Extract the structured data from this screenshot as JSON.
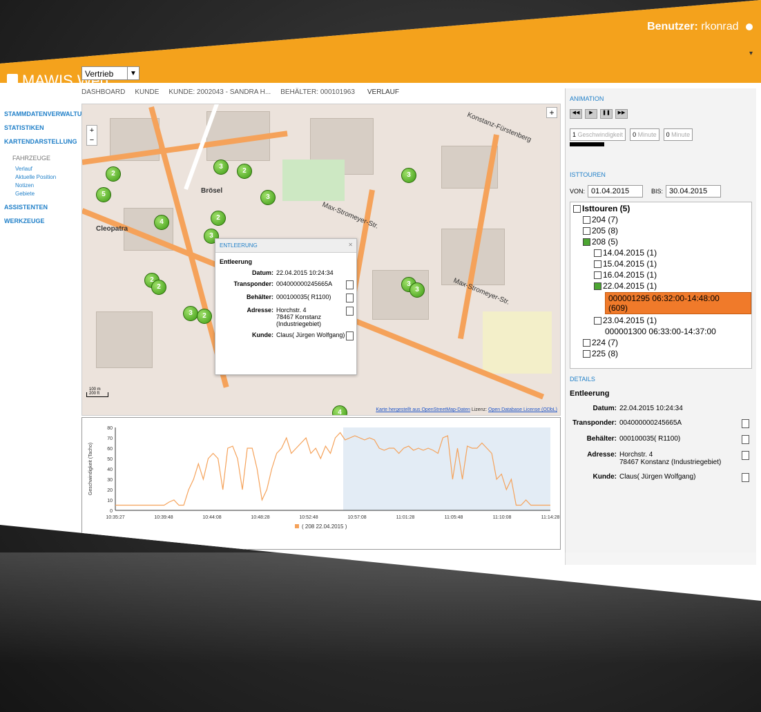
{
  "topbar": {
    "user_label": "Benutzer:",
    "user_name": "rkonrad",
    "app_title": "MAWIS Web",
    "mode": "Vertrieb"
  },
  "sidebar": {
    "items": [
      "STAMMDATENVERWALTUNG",
      "STATISTIKEN",
      "KARTENDARSTELLUNG"
    ],
    "sub_header": "FAHRZEUGE",
    "links": [
      "Verlauf",
      "Aktuelle Position",
      "Notizen",
      "Gebiete"
    ],
    "items2": [
      "ASSISTENTEN",
      "WERKZEUGE"
    ]
  },
  "breadcrumbs": [
    "DASHBOARD",
    "KUNDE",
    "KUNDE: 2002043 - SANDRA H...",
    "BEHÄLTER: 000101963",
    "VERLAUF"
  ],
  "map": {
    "attribution_link1": "Karte hergestellt aus OpenStreetMap-Daten",
    "attribution_mid": "Lizenz:",
    "attribution_link2": "Open Database License (ODbL)",
    "streets": [
      "Max-Stromeyer-Str.",
      "Max-Stromeyer-Str.",
      "Konstanz-Fürstenberg"
    ],
    "labels": [
      "Cleopatra",
      "Brösel"
    ],
    "markers": [
      "2",
      "5",
      "4",
      "3",
      "2",
      "2",
      "3",
      "3",
      "3",
      "2",
      "2",
      "2",
      "3",
      "3",
      "3",
      "4"
    ],
    "scale": [
      "100 m",
      "200 ft"
    ]
  },
  "popup": {
    "title": "ENTLEERUNG",
    "heading": "Entleerung",
    "rows": [
      {
        "k": "Datum:",
        "v": "22.04.2015 10:24:34"
      },
      {
        "k": "Transponder:",
        "v": "004000000245665A"
      },
      {
        "k": "Behälter:",
        "v": "000100035( R1100)"
      },
      {
        "k": "Adresse:",
        "v": "Horchstr. 4",
        "v2": "78467 Konstanz (Industriegebiet)"
      },
      {
        "k": "Kunde:",
        "v": "Claus( Jürgen Wolfgang)"
      }
    ]
  },
  "chart_data": {
    "type": "line",
    "ylabel": "Geschwindigkeit (Tacho)",
    "ylim": [
      0,
      80
    ],
    "yticks": [
      "80",
      "70",
      "60",
      "50",
      "40",
      "30",
      "20",
      "10",
      "0"
    ],
    "x_ticks": [
      "10:35:27",
      "10:39:48",
      "10:44:08",
      "10:48:28",
      "10:52:48",
      "10:57:08",
      "11:01:28",
      "11:05:48",
      "11:10:08",
      "11:14:28"
    ],
    "legend": "( 208 22.04.2015 )",
    "values": [
      5,
      5,
      5,
      5,
      5,
      5,
      5,
      5,
      5,
      5,
      5,
      8,
      10,
      5,
      5,
      20,
      30,
      45,
      30,
      50,
      55,
      50,
      20,
      60,
      62,
      50,
      20,
      60,
      60,
      40,
      10,
      20,
      40,
      55,
      60,
      70,
      55,
      60,
      65,
      70,
      55,
      60,
      50,
      62,
      55,
      70,
      75,
      68,
      70,
      72,
      70,
      68,
      70,
      68,
      60,
      58,
      60,
      60,
      55,
      60,
      62,
      58,
      60,
      58,
      60,
      58,
      55,
      70,
      72,
      30,
      60,
      30,
      62,
      60,
      60,
      65,
      60,
      55,
      30,
      35,
      20,
      30,
      5,
      5,
      10,
      5,
      5,
      5,
      5,
      5
    ]
  },
  "rpanel": {
    "animation": "ANIMATION",
    "spin1": "1",
    "spin1_unit": "Geschwindigkeit",
    "spin2": "0",
    "spin2_unit": "Minute",
    "spin3": "0",
    "spin3_unit": "Minute",
    "isttouren": "ISTTOUREN",
    "von_label": "VON:",
    "von": "01.04.2015",
    "bis_label": "BIS:",
    "bis": "30.04.2015",
    "tree": {
      "root": "Isttouren (5)",
      "t204": "204 (7)",
      "t205": "205 (8)",
      "t208": "208 (5)",
      "d1": "14.04.2015 (1)",
      "d2": "15.04.2015 (1)",
      "d3": "16.04.2015 (1)",
      "d4": "22.04.2015 (1)",
      "sel1": "000001295 06:32:00-14:48:00",
      "sel2": "(609)",
      "d5": "23.04.2015 (1)",
      "trip2": "000001300 06:33:00-14:37:00",
      "t224": "224 (7)",
      "t225": "225 (8)"
    },
    "details_label": "DETAILS",
    "details": {
      "heading": "Entleerung",
      "rows": [
        {
          "k": "Datum:",
          "v": "22.04.2015 10:24:34"
        },
        {
          "k": "Transponder:",
          "v": "004000000245665A"
        },
        {
          "k": "Behälter:",
          "v": "000100035( R1100)"
        },
        {
          "k": "Adresse:",
          "v": "Horchstr. 4",
          "v2": "78467 Konstanz (Industriegebiet)"
        },
        {
          "k": "Kunde:",
          "v": "Claus( Jürgen Wolfgang)"
        }
      ]
    }
  },
  "colors": {
    "accent": "#f4a21c",
    "link": "#1f7fc8",
    "route": "#f5a25a",
    "selected": "#f07a2a"
  }
}
